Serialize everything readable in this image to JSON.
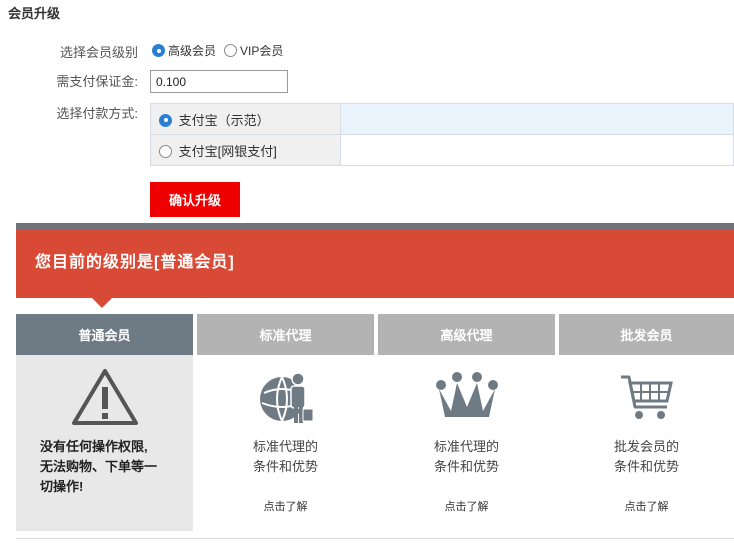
{
  "page_title": "会员升级",
  "form": {
    "level_label": "选择会员级别",
    "level_options": [
      {
        "label": "高级会员",
        "checked": true
      },
      {
        "label": "VIP会员",
        "checked": false
      }
    ],
    "deposit_label": "需支付保证金:",
    "deposit_value": "0.100",
    "payment_label": "选择付款方式:",
    "payment_options": [
      {
        "label": "支付宝（示范）",
        "checked": true
      },
      {
        "label": "支付宝[网银支付]",
        "checked": false
      }
    ],
    "confirm_label": "确认升级"
  },
  "banner": {
    "text": "您目前的级别是[普通会员]",
    "color": "#d84a35"
  },
  "tabs": [
    {
      "label": "普通会员",
      "active": true
    },
    {
      "label": "标准代理",
      "active": false
    },
    {
      "label": "高级代理",
      "active": false
    },
    {
      "label": "批发会员",
      "active": false
    }
  ],
  "panels": {
    "normal": {
      "icon": "warning-icon",
      "lines": [
        "没有任何操作权限,",
        "无法购物、下单等一",
        "切操作!"
      ]
    },
    "standard_agent": {
      "icon": "globe-person-icon",
      "lines": [
        "标准代理的",
        "条件和优势"
      ],
      "link": "点击了解"
    },
    "senior_agent": {
      "icon": "crown-icon",
      "lines": [
        "标准代理的",
        "条件和优势"
      ],
      "link": "点击了解"
    },
    "wholesale": {
      "icon": "shopping-cart-icon",
      "lines": [
        "批发会员的",
        "条件和优势"
      ],
      "link": "点击了解"
    }
  }
}
